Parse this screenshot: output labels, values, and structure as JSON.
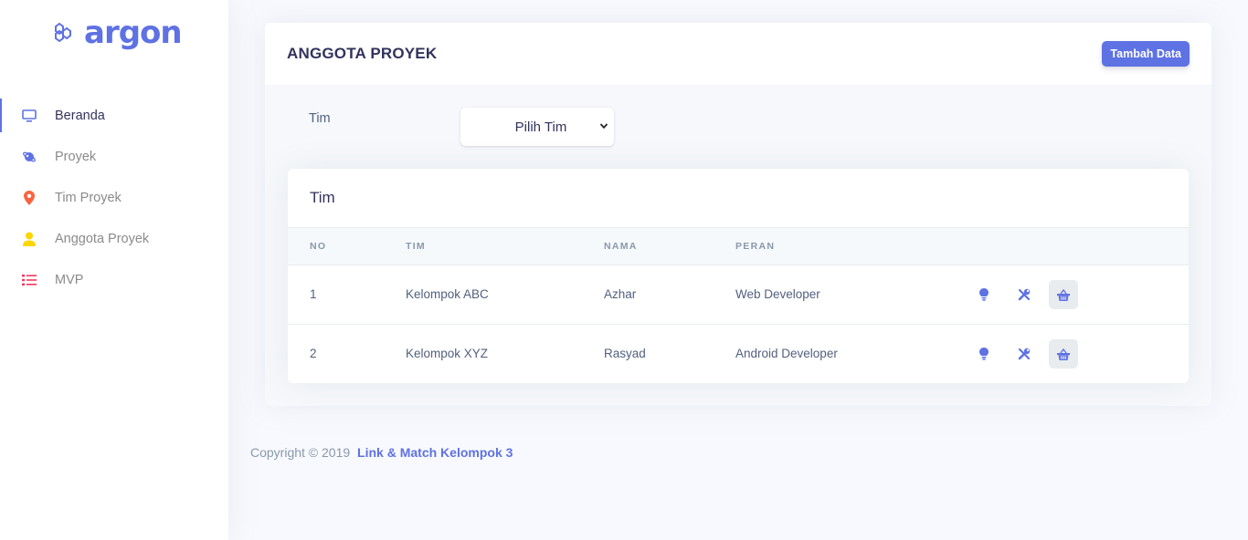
{
  "brand": {
    "name": "argon",
    "icon": "hexagons-icon"
  },
  "colors": {
    "primary": "#5e72e4",
    "orange": "#fb6340",
    "yellow": "#ffd600",
    "red": "#f5365c"
  },
  "sidebar": {
    "items": [
      {
        "label": "Beranda",
        "icon": "tv-icon",
        "active": true
      },
      {
        "label": "Proyek",
        "icon": "planet-icon"
      },
      {
        "label": "Tim Proyek",
        "icon": "pin-icon"
      },
      {
        "label": "Anggota Proyek",
        "icon": "user-icon"
      },
      {
        "label": "MVP",
        "icon": "list-icon"
      }
    ]
  },
  "header": {
    "title": "ANGGOTA PROYEK",
    "add_button": "Tambah Data"
  },
  "filter": {
    "label": "Tim",
    "selected": "Pilih Tim"
  },
  "table": {
    "title": "Tim",
    "columns": [
      "NO",
      "TIM",
      "NAMA",
      "PERAN"
    ],
    "rows": [
      {
        "no": "1",
        "tim": "Kelompok ABC",
        "nama": "Azhar",
        "peran": "Web Developer"
      },
      {
        "no": "2",
        "tim": "Kelompok XYZ",
        "nama": "Rasyad",
        "peran": "Android Developer"
      }
    ],
    "actions": [
      "bulb-icon",
      "tools-icon",
      "basket-icon"
    ]
  },
  "footer": {
    "copyright": "Copyright © 2019",
    "link": "Link & Match Kelompok 3"
  }
}
